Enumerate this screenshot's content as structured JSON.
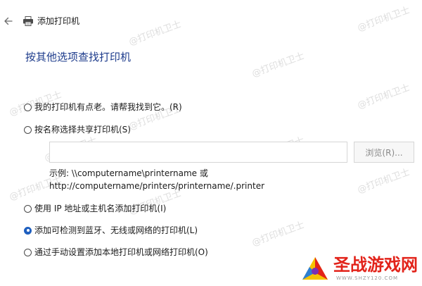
{
  "window": {
    "title": "添加打印机"
  },
  "page": {
    "heading": "按其他选项查找打印机"
  },
  "options": [
    {
      "label": "我的打印机有点老。请帮我找到它。(R)",
      "selected": false
    },
    {
      "label": "按名称选择共享打印机(S)",
      "selected": false
    },
    {
      "label": "使用 IP 地址或主机名添加打印机(I)",
      "selected": false
    },
    {
      "label": "添加可检测到蓝牙、无线或网络的打印机(L)",
      "selected": true
    },
    {
      "label": "通过手动设置添加本地打印机或网络打印机(O)",
      "selected": false
    }
  ],
  "share_input": {
    "value": "",
    "placeholder": ""
  },
  "browse_button": {
    "label": "浏览(R)..."
  },
  "example": {
    "line1": "示例: \\\\computername\\printername 或",
    "line2": "http://computername/printers/printername/.printer"
  },
  "watermark": {
    "text": "@打印机卫士"
  },
  "logo": {
    "text": "圣战游戏网",
    "url": "WWW.SHZY120.COM"
  },
  "colors": {
    "heading": "#1e3c8c",
    "radio_selected": "#1f5fbf",
    "logo_red": "#e2231a"
  },
  "icons": {
    "back": "back-arrow-icon",
    "printer": "printer-icon",
    "logo": "logo-mark-icon"
  }
}
